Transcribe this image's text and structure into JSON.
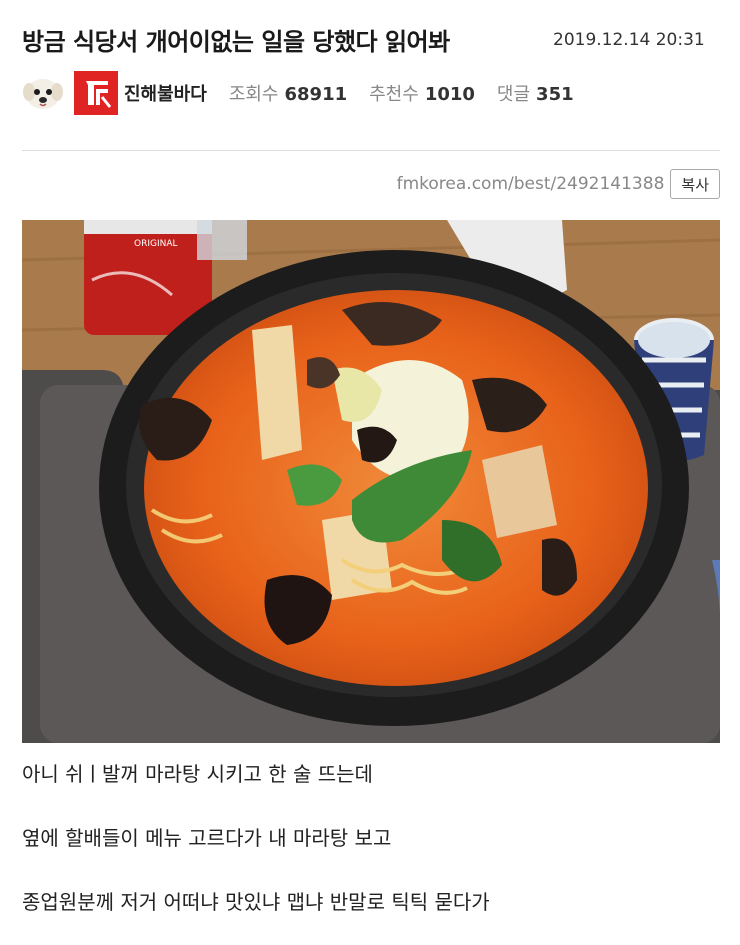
{
  "post": {
    "title": "방금 식당서 개어이없는 일을 당했다 읽어봐",
    "datetime": "2019.12.14 20:31",
    "author": "진해불바다",
    "stats": {
      "views_label": "조회수",
      "views": "68911",
      "recommend_label": "추천수",
      "recommend": "1010",
      "comments_label": "댓글",
      "comments": "351"
    },
    "url": "fmkorea.com/best/2492141388",
    "copy_label": "복사",
    "body_lines": [
      "아니 쉬ㅣ발꺼 마라탕 시키고 한 술 뜨는데",
      "옆에 할배들이 메뉴 고르다가 내 마라탕 보고",
      "종업원분께 저거 어떠냐 맛있냐 맵냐 반말로 틱틱 묻다가"
    ]
  },
  "photo": {
    "can_text": "ORIGINAL"
  },
  "colors": {
    "badge": "#e02424",
    "broth": "#e8621a",
    "bowl": "#1c1c1c",
    "table": "#a87a4c"
  }
}
